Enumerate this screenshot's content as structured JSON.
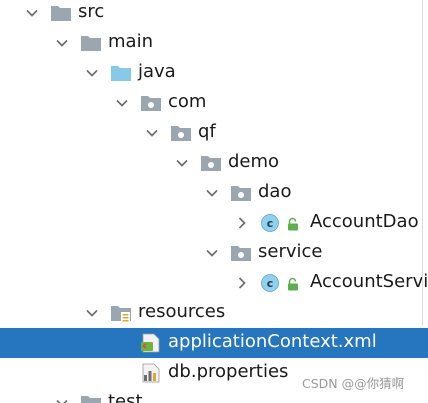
{
  "tree": {
    "rows": [
      {
        "name": "tree-node-src",
        "label": "src",
        "icon": "folder-icon",
        "chevron": "chevron-down-icon",
        "level": 0
      },
      {
        "name": "tree-node-main",
        "label": "main",
        "icon": "folder-icon",
        "chevron": "chevron-down-icon",
        "level": 1
      },
      {
        "name": "tree-node-java",
        "label": "java",
        "icon": "source-root-folder-icon",
        "chevron": "chevron-down-icon",
        "level": 2
      },
      {
        "name": "tree-node-com",
        "label": "com",
        "icon": "package-icon",
        "chevron": "chevron-down-icon",
        "level": 3
      },
      {
        "name": "tree-node-qf",
        "label": "qf",
        "icon": "package-icon",
        "chevron": "chevron-down-icon",
        "level": 4
      },
      {
        "name": "tree-node-demo",
        "label": "demo",
        "icon": "package-icon",
        "chevron": "chevron-down-icon",
        "level": 5
      },
      {
        "name": "tree-node-dao",
        "label": "dao",
        "icon": "package-icon",
        "chevron": "chevron-down-icon",
        "level": 6
      },
      {
        "name": "tree-node-accountdao",
        "label": "AccountDao",
        "icon": "java-class-icon",
        "badge": "lock-icon",
        "chevron": "chevron-right-icon",
        "level": 7
      },
      {
        "name": "tree-node-service",
        "label": "service",
        "icon": "package-icon",
        "chevron": "chevron-down-icon",
        "level": 6
      },
      {
        "name": "tree-node-accountservice",
        "label": "AccountServic",
        "icon": "java-class-icon",
        "badge": "lock-icon",
        "chevron": "chevron-right-icon",
        "level": 7
      },
      {
        "name": "tree-node-resources",
        "label": "resources",
        "icon": "resources-folder-icon",
        "chevron": "chevron-down-icon",
        "level": 2
      },
      {
        "name": "tree-node-applicationcontext",
        "label": "applicationContext.xml",
        "icon": "spring-xml-file-icon",
        "level": 3,
        "selected": true
      },
      {
        "name": "tree-node-dbproperties",
        "label": "db.properties",
        "icon": "properties-file-icon",
        "level": 3
      },
      {
        "name": "tree-node-test",
        "label": "test",
        "icon": "folder-icon",
        "chevron": "chevron-down-icon",
        "level": 1
      }
    ]
  },
  "watermark": "CSDN @@你猜啊",
  "colors": {
    "selection": "#2675BF",
    "folder": "#9aa7b0",
    "source_root": "#87c9e8",
    "class_circle": "#8fd1ee",
    "lock": "#5fae4f"
  }
}
